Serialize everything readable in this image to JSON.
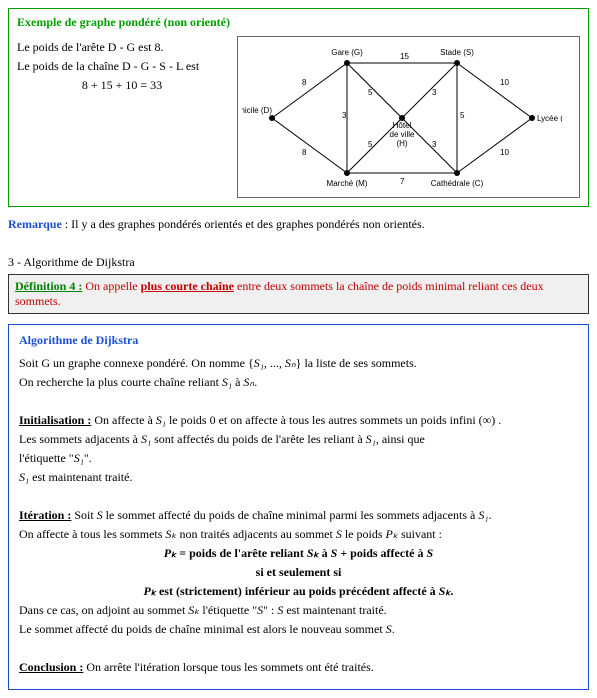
{
  "example": {
    "title": "Exemple de graphe pondéré (non orienté)",
    "line1": "Le poids de l'arête D - G est 8.",
    "line2a": "Le poids de la chaîne D - G - S - L est",
    "line2b": "8 + 15 + 10 = 33"
  },
  "graph": {
    "nodes": {
      "D": "Domicile (D)",
      "G": "Gare (G)",
      "S": "Stade (S)",
      "L": "Lycée (L)",
      "H1": "Hôtel",
      "H2": "de ville",
      "H3": "(H)",
      "M": "Marché (M)",
      "C": "Cathédrale (C)"
    },
    "weights": {
      "DG": "8",
      "GS": "15",
      "SL": "10",
      "DM": "8",
      "MC": "7",
      "CL": "10",
      "GH": "5",
      "SH": "3",
      "MH": "5",
      "CH": "3",
      "GM": "3",
      "SC": "5"
    }
  },
  "remark": {
    "label": "Remarque",
    "text": ": Il y a des graphes pondérés orientés et des graphes pondérés non orientés."
  },
  "section3": "3 - Algorithme de Dijkstra",
  "def4": {
    "label": "Définition 4 :",
    "part1": "On appelle ",
    "keyword": "plus courte chaîne",
    "part2": " entre deux sommets la chaîne de poids minimal reliant ces deux sommets."
  },
  "algo": {
    "title": "Algorithme de Dijkstra",
    "intro1a": "Soit G un graphe connexe pondéré. On nomme ",
    "intro1b": " la liste de ses sommets.",
    "intro2a": "On recherche la plus courte chaîne reliant ",
    "intro2b": " à ",
    "intro2c": ".",
    "init_label": "Initialisation :",
    "init1a": "On affecte à ",
    "init1b": " le poids 0 et on affecte à tous les autres sommets un poids infini (∞) .",
    "init2a": "Les sommets adjacents à ",
    "init2b": " sont affectés du poids de l'arête les reliant à ",
    "init2c": ", ainsi que",
    "init3a": "l'étiquette \"",
    "init3b": "\".",
    "init4a": "",
    "init4b": " est maintenant traité.",
    "iter_label": "Itération :",
    "iter1a": "Soit ",
    "iter1b": " le sommet affecté du poids de chaîne minimal parmi les sommets adjacents à ",
    "iter1c": ".",
    "iter2a": "On affecte à tous les sommets ",
    "iter2b": " non traités adjacents au sommet ",
    "iter2c": " le poids ",
    "iter2d": " suivant :",
    "iter3a": " = poids de l'arête reliant ",
    "iter3b": " à ",
    "iter3c": " + poids affecté à ",
    "iter4": "si et seulement si",
    "iter5a": " est (strictement) inférieur au poids précédent affecté à ",
    "iter5b": ".",
    "iter6a": "Dans ce cas, on adjoint au sommet ",
    "iter6b": " l'étiquette \"",
    "iter6c": "\" : ",
    "iter6d": " est maintenant traité.",
    "iter7a": "Le sommet affecté du poids de chaîne minimal est alors le nouveau sommet ",
    "iter7b": ".",
    "concl_label": "Conclusion :",
    "concl": "On arrête l'itération lorsque tous les sommets ont été traités."
  },
  "sym": {
    "S1": "S₁",
    "Sn": "Sₙ",
    "Sk": "Sₖ",
    "S": "S",
    "Pk": "Pₖ",
    "list_open": "{",
    "list_sep": ", ..., ",
    "list_close": "}"
  }
}
